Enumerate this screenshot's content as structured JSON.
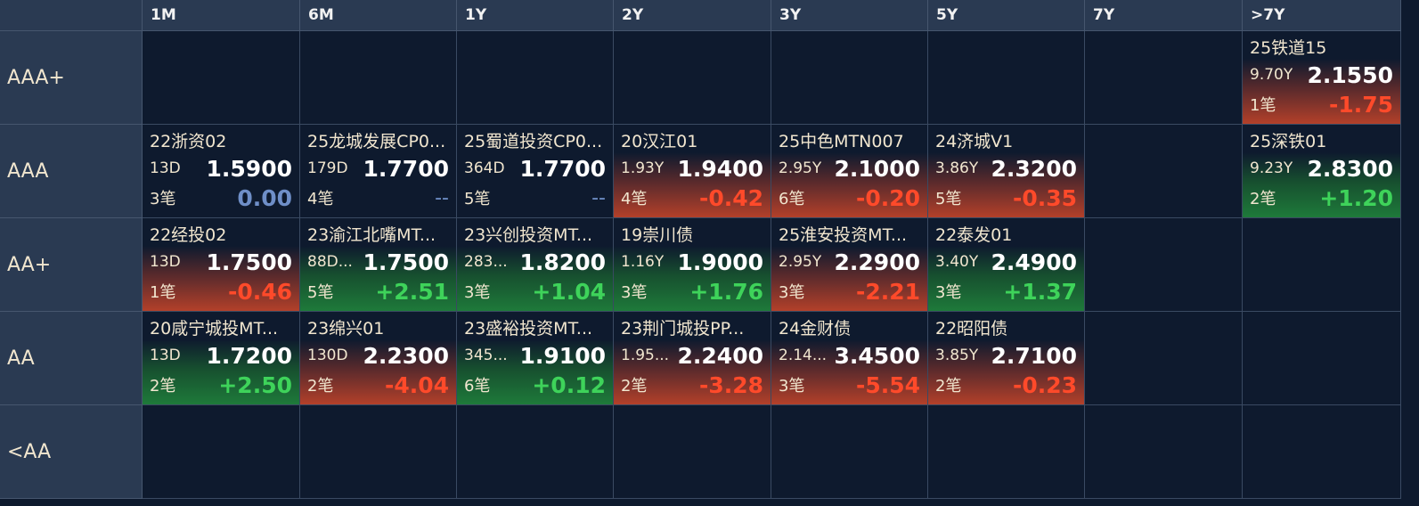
{
  "corner": "",
  "columns": [
    "1M",
    "6M",
    "1Y",
    "2Y",
    "3Y",
    "5Y",
    "7Y",
    ">7Y"
  ],
  "rows": [
    {
      "label": "AAA+",
      "cells": [
        null,
        null,
        null,
        null,
        null,
        null,
        null,
        {
          "name": "25铁道15",
          "term": "9.70Y",
          "yield": "2.1550",
          "count": "1笔",
          "change": "-1.75",
          "trend": "red"
        }
      ]
    },
    {
      "label": "AAA",
      "cells": [
        {
          "name": "22浙资02",
          "term": "13D",
          "yield": "1.5900",
          "count": "3笔",
          "change": "0.00",
          "trend": "zero"
        },
        {
          "name": "25龙城发展CP0...",
          "term": "179D",
          "yield": "1.7700",
          "count": "4笔",
          "change": "--",
          "trend": "none"
        },
        {
          "name": "25蜀道投资CP0...",
          "term": "364D",
          "yield": "1.7700",
          "count": "5笔",
          "change": "--",
          "trend": "none"
        },
        {
          "name": "20汉江01",
          "term": "1.93Y",
          "yield": "1.9400",
          "count": "4笔",
          "change": "-0.42",
          "trend": "red"
        },
        {
          "name": "25中色MTN007",
          "term": "2.95Y",
          "yield": "2.1000",
          "count": "6笔",
          "change": "-0.20",
          "trend": "red"
        },
        {
          "name": "24济城V1",
          "term": "3.86Y",
          "yield": "2.3200",
          "count": "5笔",
          "change": "-0.35",
          "trend": "red"
        },
        null,
        {
          "name": "25深铁01",
          "term": "9.23Y",
          "yield": "2.8300",
          "count": "2笔",
          "change": "+1.20",
          "trend": "green"
        }
      ]
    },
    {
      "label": "AA+",
      "cells": [
        {
          "name": "22经投02",
          "term": "13D",
          "yield": "1.7500",
          "count": "1笔",
          "change": "-0.46",
          "trend": "red"
        },
        {
          "name": "23渝江北嘴MT...",
          "term": "88D...",
          "yield": "1.7500",
          "count": "5笔",
          "change": "+2.51",
          "trend": "green"
        },
        {
          "name": "23兴创投资MT...",
          "term": "283...",
          "yield": "1.8200",
          "count": "3笔",
          "change": "+1.04",
          "trend": "green"
        },
        {
          "name": "19崇川债",
          "term": "1.16Y",
          "yield": "1.9000",
          "count": "3笔",
          "change": "+1.76",
          "trend": "green"
        },
        {
          "name": "25淮安投资MT...",
          "term": "2.95Y",
          "yield": "2.2900",
          "count": "3笔",
          "change": "-2.21",
          "trend": "red"
        },
        {
          "name": "22泰发01",
          "term": "3.40Y",
          "yield": "2.4900",
          "count": "3笔",
          "change": "+1.37",
          "trend": "green"
        },
        null,
        null
      ]
    },
    {
      "label": "AA",
      "cells": [
        {
          "name": "20咸宁城投MT...",
          "term": "13D",
          "yield": "1.7200",
          "count": "2笔",
          "change": "+2.50",
          "trend": "green"
        },
        {
          "name": "23绵兴01",
          "term": "130D",
          "yield": "2.2300",
          "count": "2笔",
          "change": "-4.04",
          "trend": "red"
        },
        {
          "name": "23盛裕投资MT...",
          "term": "345...",
          "yield": "1.9100",
          "count": "6笔",
          "change": "+0.12",
          "trend": "green"
        },
        {
          "name": "23荆门城投PP...",
          "term": "1.95...",
          "yield": "2.2400",
          "count": "2笔",
          "change": "-3.28",
          "trend": "red"
        },
        {
          "name": "24金财债",
          "term": "2.14...",
          "yield": "3.4500",
          "count": "3笔",
          "change": "-5.54",
          "trend": "red"
        },
        {
          "name": "22昭阳债",
          "term": "3.85Y",
          "yield": "2.7100",
          "count": "2笔",
          "change": "-0.23",
          "trend": "red"
        },
        null,
        null
      ]
    },
    {
      "label": "<AA",
      "cells": [
        null,
        null,
        null,
        null,
        null,
        null,
        null,
        null
      ]
    }
  ]
}
